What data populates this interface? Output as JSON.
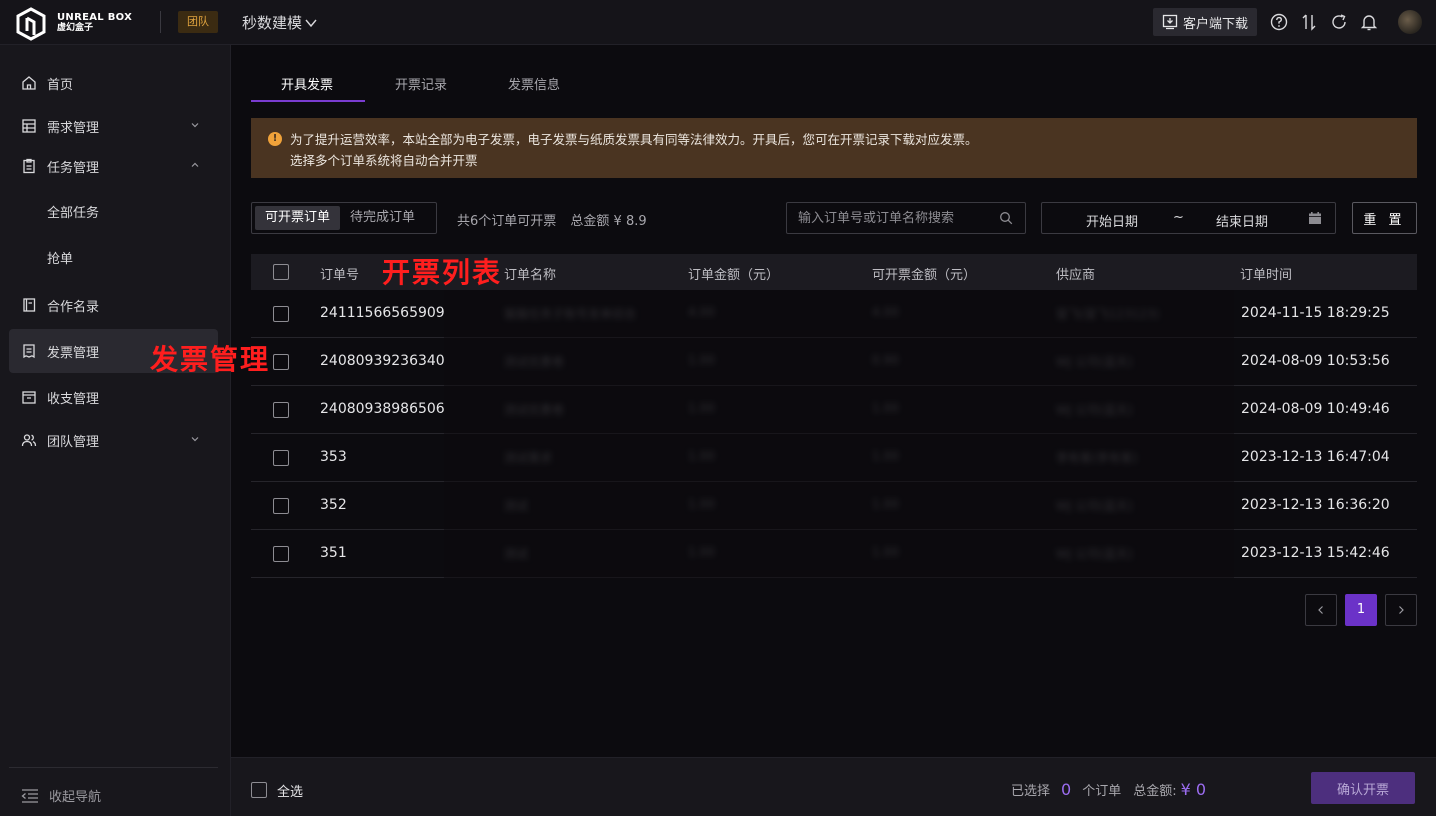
{
  "topbar": {
    "brand_line1": "UNREAL BOX",
    "brand_line2": "虚幻盒子",
    "team_badge": "团队",
    "project": "秒数建模",
    "download_label": "客户端下载",
    "icons": [
      "help-icon",
      "sort-icon",
      "refresh-icon",
      "bell-icon"
    ]
  },
  "sidebar": {
    "items": [
      {
        "label": "首页",
        "icon": "home-icon"
      },
      {
        "label": "需求管理",
        "icon": "table-icon"
      },
      {
        "label": "任务管理",
        "icon": "clipboard-icon"
      },
      {
        "label": "全部任务"
      },
      {
        "label": "抢单"
      },
      {
        "label": "合作名录",
        "icon": "book-icon"
      },
      {
        "label": "发票管理",
        "icon": "invoice-icon"
      },
      {
        "label": "收支管理",
        "icon": "wallet-icon"
      },
      {
        "label": "团队管理",
        "icon": "team-icon"
      }
    ],
    "collapse_label": "收起导航"
  },
  "tabs": [
    "开具发票",
    "开票记录",
    "发票信息"
  ],
  "notice": {
    "line1": "为了提升运营效率，本站全部为电子发票，电子发票与纸质发票具有同等法律效力。开具后，您可在开票记录下载对应发票。",
    "line2": "选择多个订单系统将自动合并开票"
  },
  "filter": {
    "seg_options": [
      "可开票订单",
      "待完成订单"
    ],
    "summary_count": "共6个订单可开票",
    "summary_total": "总金额 ¥ 8.9",
    "search_placeholder": "输入订单号或订单名称搜索",
    "start_date": "开始日期",
    "tilde": "~",
    "end_date": "结束日期",
    "reset": "重 置"
  },
  "table": {
    "headers": [
      "订单号",
      "订单名称",
      "订单金额（元）",
      "可开票金额（元）",
      "供应商",
      "订单时间"
    ],
    "rows": [
      {
        "id": "24111566565909",
        "name": "猫猫任务子账号发单综合",
        "amount": "4.00",
        "invoiceable": "4.00",
        "supplier": "冒飞(冒飞123123)",
        "time": "2024-11-15 18:29:25"
      },
      {
        "id": "24080939236340",
        "name": "测试优惠卷",
        "amount": "1.00",
        "invoiceable": "0.90",
        "supplier": "WJ 公司(蓝天)",
        "time": "2024-08-09 10:53:56"
      },
      {
        "id": "24080938986506",
        "name": "测试优惠卷",
        "amount": "1.00",
        "invoiceable": "1.00",
        "supplier": "WJ 公司(蓝天)",
        "time": "2024-08-09 10:49:46"
      },
      {
        "id": "353",
        "name": "测试需求",
        "amount": "1.00",
        "invoiceable": "1.00",
        "supplier": "李有客(李有客)",
        "time": "2023-12-13 16:47:04"
      },
      {
        "id": "352",
        "name": "测试",
        "amount": "1.00",
        "invoiceable": "1.00",
        "supplier": "WJ 公司(蓝天)",
        "time": "2023-12-13 16:36:20"
      },
      {
        "id": "351",
        "name": "测试",
        "amount": "1.00",
        "invoiceable": "1.00",
        "supplier": "WJ 公司(蓝天)",
        "time": "2023-12-13 15:42:46"
      }
    ]
  },
  "pager": {
    "current": "1"
  },
  "footer": {
    "select_all": "全选",
    "selected_prefix": "已选择",
    "selected_count": "0",
    "selected_suffix": "个订单",
    "total_label": "总金额:",
    "total_value": "¥ 0",
    "confirm": "确认开票"
  },
  "annotations": {
    "menu": "发票管理",
    "list": "开票列表"
  },
  "colors": {
    "accent": "#6b32c8",
    "notice_bg": "#4a3421",
    "warn": "#f0a23a",
    "annotation": "#ff1e1e"
  }
}
